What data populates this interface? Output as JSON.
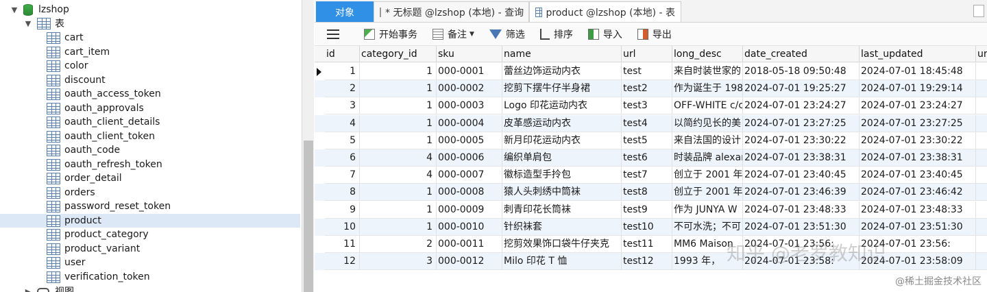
{
  "tree": {
    "database": "lzshop",
    "tables_folder": "表",
    "tables": [
      "cart",
      "cart_item",
      "color",
      "discount",
      "oauth_access_token",
      "oauth_approvals",
      "oauth_client_details",
      "oauth_client_token",
      "oauth_code",
      "oauth_refresh_token",
      "order_detail",
      "orders",
      "password_reset_token",
      "product",
      "product_category",
      "product_variant",
      "user",
      "verification_token"
    ],
    "selected_table": "product",
    "views_folder": "视图"
  },
  "tabs": [
    {
      "label": "对象"
    },
    {
      "label": "* 无标题 @lzshop (本地) - 查询"
    },
    {
      "label": "product @lzshop (本地) - 表"
    }
  ],
  "toolbar": {
    "begin_transaction": "开始事务",
    "memo": "备注",
    "filter": "筛选",
    "sort": "排序",
    "import": "导入",
    "export": "导出"
  },
  "columns": [
    "id",
    "category_id",
    "sku",
    "name",
    "url",
    "long_desc",
    "date_created",
    "last_updated",
    "ur"
  ],
  "rows": [
    {
      "id": "1",
      "category_id": "1",
      "sku": "000-0001",
      "name": "蕾丝边饰运动内衣",
      "url": "test",
      "long_desc": "来自时装世家的",
      "date_created": "2018-05-18 09:50:48",
      "last_updated": "2024-07-01 18:45:48"
    },
    {
      "id": "2",
      "category_id": "1",
      "sku": "000-0002",
      "name": "挖剪下摆牛仔半身裙",
      "url": "test2",
      "long_desc": "作为诞生于 198",
      "date_created": "2024-07-01 19:25:27",
      "last_updated": "2024-07-01 19:29:14"
    },
    {
      "id": "3",
      "category_id": "1",
      "sku": "000-0003",
      "name": "Logo 印花运动内衣",
      "url": "test3",
      "long_desc": "OFF-WHITE c/c",
      "date_created": "2024-07-01 23:24:27",
      "last_updated": "2024-07-01 23:24:27"
    },
    {
      "id": "4",
      "category_id": "1",
      "sku": "000-0004",
      "name": "皮革感运动内衣",
      "url": "test4",
      "long_desc": "以简约见长的美",
      "date_created": "2024-07-01 23:27:25",
      "last_updated": "2024-07-01 23:27:25"
    },
    {
      "id": "5",
      "category_id": "1",
      "sku": "000-0005",
      "name": "新月印花运动内衣",
      "url": "test5",
      "long_desc": "来自法国的设计",
      "date_created": "2024-07-01 23:30:22",
      "last_updated": "2024-07-01 23:30:22"
    },
    {
      "id": "6",
      "category_id": "4",
      "sku": "000-0006",
      "name": "编织单肩包",
      "url": "test6",
      "long_desc": "时装品牌 alexar",
      "date_created": "2024-07-01 23:38:31",
      "last_updated": "2024-07-01 23:38:31"
    },
    {
      "id": "7",
      "category_id": "4",
      "sku": "000-0007",
      "name": "徽标造型手拎包",
      "url": "test7",
      "long_desc": "创立于 2001 年",
      "date_created": "2024-07-01 23:40:45",
      "last_updated": "2024-07-01 23:40:45"
    },
    {
      "id": "8",
      "category_id": "1",
      "sku": "000-0008",
      "name": "猿人头刺绣中筒袜",
      "url": "test8",
      "long_desc": "创立于 2001 年",
      "date_created": "2024-07-01 23:46:39",
      "last_updated": "2024-07-01 23:46:42"
    },
    {
      "id": "9",
      "category_id": "1",
      "sku": "000-0009",
      "name": "刺青印花长筒袜",
      "url": "test9",
      "long_desc": "作为 JUNYA W",
      "date_created": "2024-07-01 23:48:33",
      "last_updated": "2024-07-01 23:48:33"
    },
    {
      "id": "10",
      "category_id": "1",
      "sku": "000-0010",
      "name": "针织袜套",
      "url": "test10",
      "long_desc": "不可水洗；不可",
      "date_created": "2024-07-01 23:51:30",
      "last_updated": "2024-07-01 23:51:30"
    },
    {
      "id": "11",
      "category_id": "2",
      "sku": "000-0011",
      "name": "挖剪效果饰口袋牛仔夹克",
      "url": "test11",
      "long_desc": "MM6 Maison",
      "date_created": "2024-07-01 23:56:",
      "last_updated": "2024-07-01 23:56:"
    },
    {
      "id": "12",
      "category_id": "3",
      "sku": "000-0012",
      "name": "Milo 印花 T 恤",
      "url": "test12",
      "long_desc": "1993 年，",
      "date_created": "2024-07-01 23:58:",
      "last_updated": "2024-07-01 23:58:09"
    }
  ],
  "watermark": "知乎 @老罗教知识",
  "credit": "@稀土掘金技术社区"
}
